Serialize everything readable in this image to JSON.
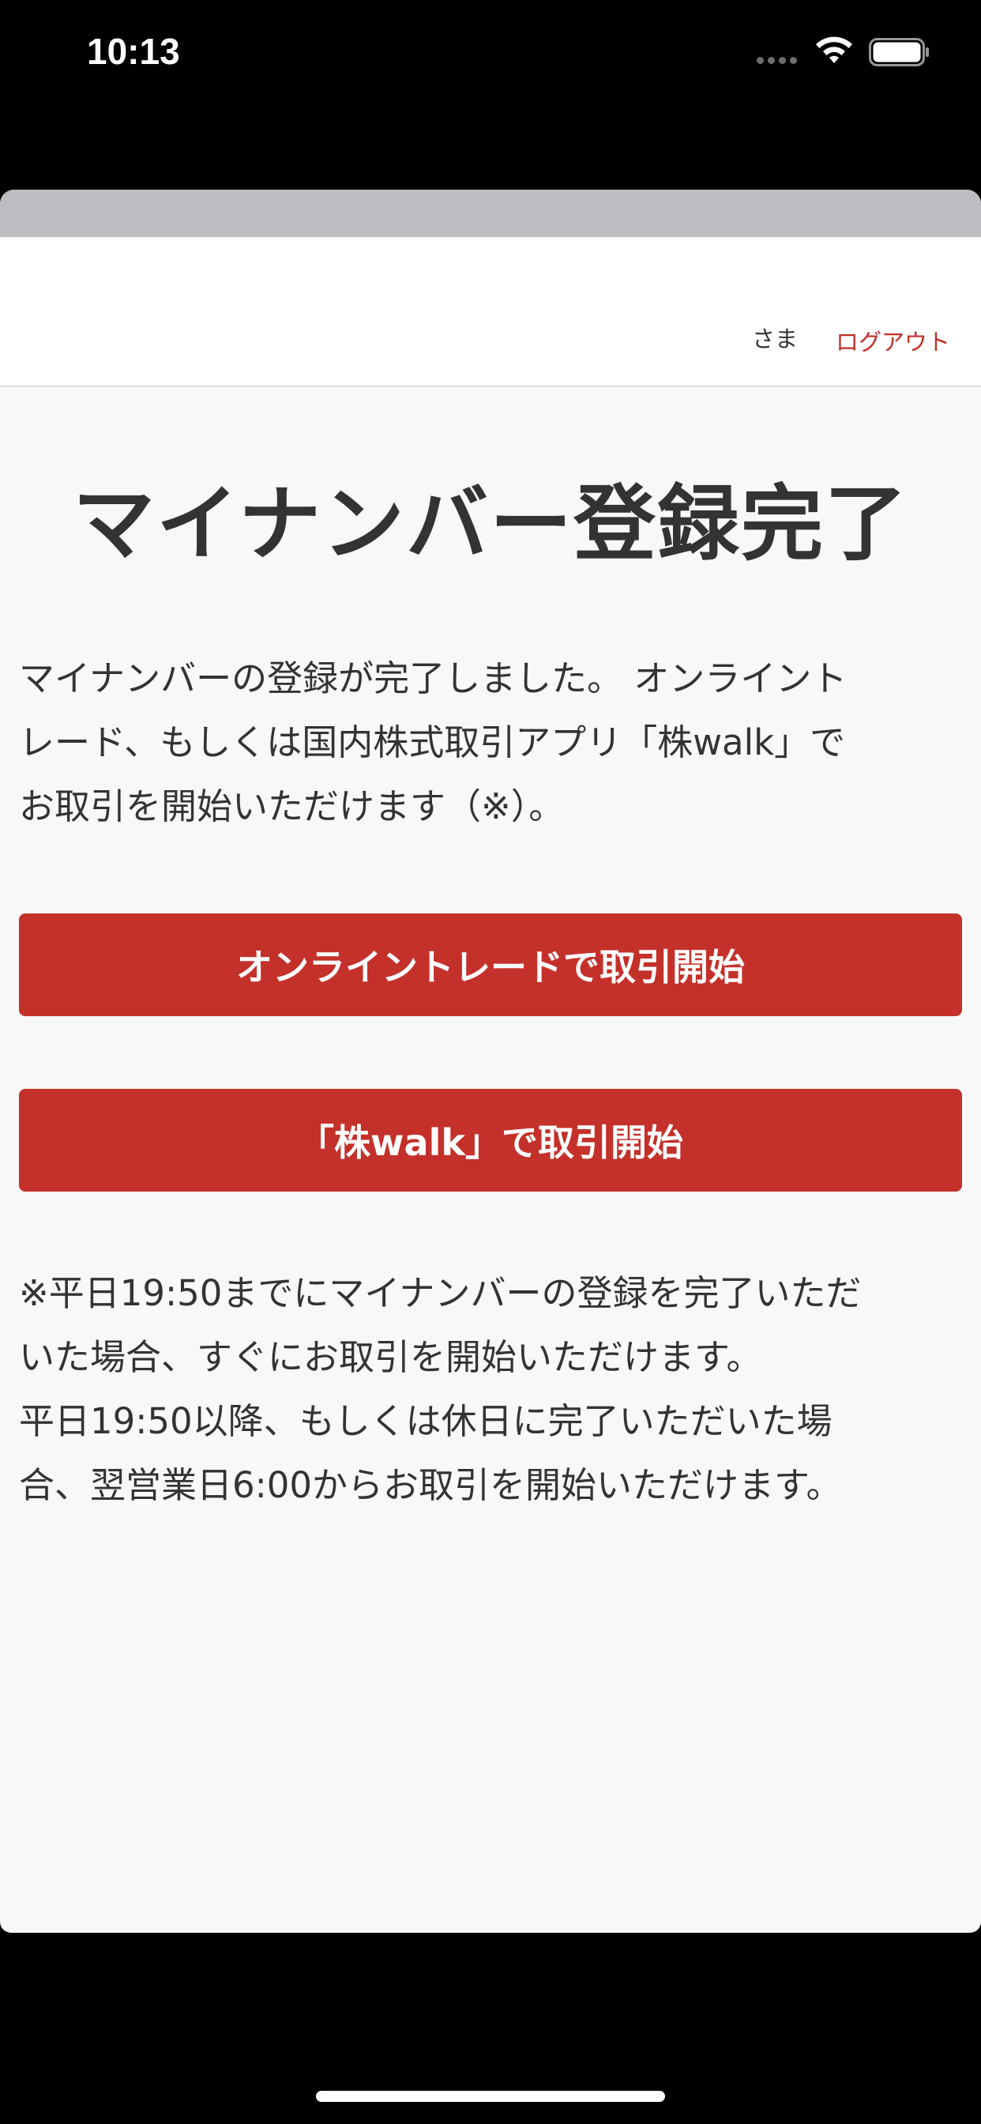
{
  "status_bar": {
    "time": "10:13",
    "icons": [
      "signal-dots-icon",
      "wifi-icon",
      "battery-icon"
    ]
  },
  "header": {
    "user_suffix": "さま",
    "logout_label": "ログアウト"
  },
  "main": {
    "title": "マイナンバー登録完了",
    "intro_lines": [
      "マイナンバーの登録が完了しました。 オンライント",
      "レード、もしくは国内株式取引アプリ「株walk」で",
      "お取引を開始いただけます（※）。"
    ],
    "online_trade_button": "オンライントレードで取引開始",
    "kabuwalk_button": "「株walk」で取引開始",
    "note_lines": [
      "※平日19:50までにマイナンバーの登録を完了いただ",
      "いた場合、すぐにお取引を開始いただけます。",
      "平日19:50以降、もしくは休日に完了いただいた場",
      "合、翌営業日6:00からお取引を開始いただけます。"
    ]
  },
  "colors": {
    "accent_red": "#c4312a",
    "link_red": "#c0302a",
    "text_dark": "#333333",
    "page_bg": "#f8f8f8",
    "device_bg": "#000000"
  }
}
